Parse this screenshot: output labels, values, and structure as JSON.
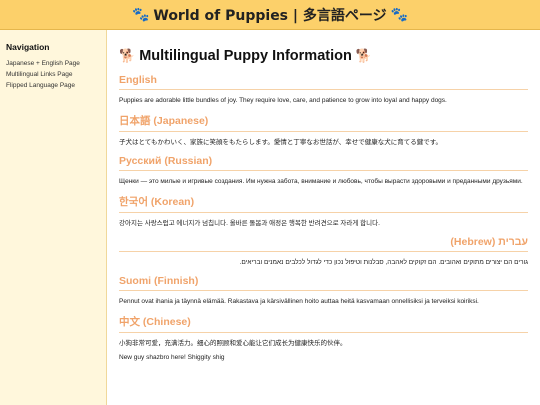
{
  "header": {
    "title": "World of Puppies | 多言語ページ",
    "paw_left": "🐾",
    "paw_right": "🐾"
  },
  "sidebar": {
    "heading": "Navigation",
    "links": [
      "Japanese + English Page",
      "Multilingual Links Page",
      "Flipped Language Page"
    ]
  },
  "main": {
    "title": "Multilingual Puppy Information",
    "dog_left": "🐕",
    "dog_right": "🐕",
    "sections": [
      {
        "heading": "English",
        "text": "Puppies are adorable little bundles of joy. They require love, care, and patience to grow into loyal and happy dogs."
      },
      {
        "heading": "日本語 (Japanese)",
        "text": "子犬はとてもかわいく、家族に笑顔をもたらします。愛情と丁寧なお世話が、幸せで健康な犬に育てる鍵です。"
      },
      {
        "heading": "Русский (Russian)",
        "text": "Щенки — это милые и игривые создания. Им нужна забота, внимание и любовь, чтобы вырасти здоровыми и преданными друзьями."
      },
      {
        "heading": "한국어 (Korean)",
        "text": "강아지는 사랑스럽고 에너지가 넘칩니다. 올바른 돌봄과 애정은 행복한 반려견으로 자라게 합니다."
      },
      {
        "heading": "עברית (Hebrew)",
        "text": "גורים הם יצורים מתוקים ואהובים. הם זקוקים לאהבה, סבלנות וטיפול נכון כדי לגדול לכלבים נאמנים ובריאים."
      },
      {
        "heading": "Suomi (Finnish)",
        "text": "Pennut ovat ihania ja täynnä elämää. Rakastava ja kärsivällinen hoito auttaa heitä kasvamaan onnellisiksi ja terveiksi koiriksi."
      },
      {
        "heading": "中文 (Chinese)",
        "text": "小狗非常可爱，充满活力。细心的照顾和爱心能让它们成长为健康快乐的伙伴。"
      }
    ],
    "extra_text": "New guy shazbro here! Shiggity shig"
  }
}
